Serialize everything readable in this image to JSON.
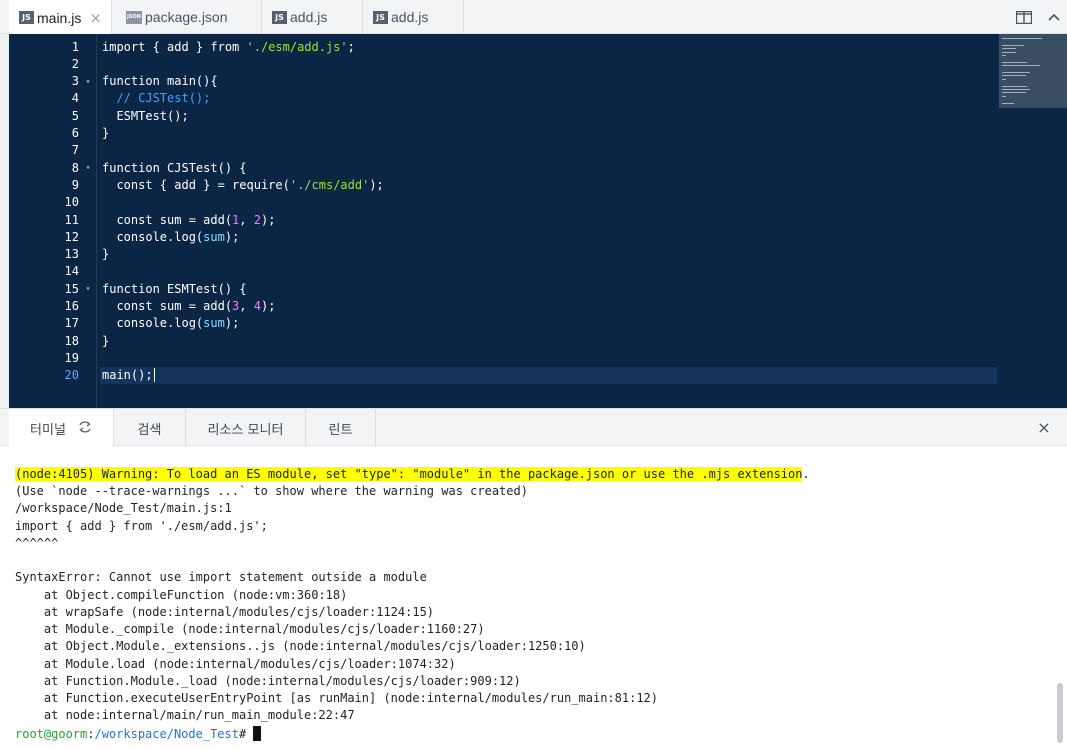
{
  "editor_tabs": [
    {
      "icon": "JS",
      "label": "main.js",
      "close": "×"
    },
    {
      "icon": "JSON",
      "label": "package.json"
    },
    {
      "icon": "JS",
      "label": "add.js"
    },
    {
      "icon": "JS",
      "label": "add.js"
    }
  ],
  "code_lines": [
    {
      "n": "1",
      "fold": "",
      "parts": [
        [
          "kw",
          "import { add } from "
        ],
        [
          "str",
          "'./esm/add.js'"
        ],
        [
          "kw",
          ";"
        ]
      ]
    },
    {
      "n": "2",
      "fold": "",
      "parts": []
    },
    {
      "n": "3",
      "fold": "▾",
      "parts": [
        [
          "kw",
          "function main(){"
        ]
      ]
    },
    {
      "n": "4",
      "fold": "",
      "parts": [
        [
          "cmt",
          "  // CJSTest();"
        ]
      ]
    },
    {
      "n": "5",
      "fold": "",
      "parts": [
        [
          "fn",
          "  ESMTest();"
        ]
      ]
    },
    {
      "n": "6",
      "fold": "",
      "parts": [
        [
          "kw",
          "}"
        ]
      ]
    },
    {
      "n": "7",
      "fold": "",
      "parts": []
    },
    {
      "n": "8",
      "fold": "▾",
      "parts": [
        [
          "kw",
          "function CJSTest() {"
        ]
      ]
    },
    {
      "n": "9",
      "fold": "",
      "parts": [
        [
          "kw",
          "  const { add } = require("
        ],
        [
          "str",
          "'./cms/add'"
        ],
        [
          "kw",
          ");"
        ]
      ]
    },
    {
      "n": "10",
      "fold": "",
      "parts": []
    },
    {
      "n": "11",
      "fold": "",
      "parts": [
        [
          "kw",
          "  const sum = add("
        ],
        [
          "num",
          "1"
        ],
        [
          "kw",
          ", "
        ],
        [
          "num",
          "2"
        ],
        [
          "kw",
          ");"
        ]
      ]
    },
    {
      "n": "12",
      "fold": "",
      "parts": [
        [
          "kw",
          "  console.log("
        ],
        [
          "vr",
          "sum"
        ],
        [
          "kw",
          ");"
        ]
      ]
    },
    {
      "n": "13",
      "fold": "",
      "parts": [
        [
          "kw",
          "}"
        ]
      ]
    },
    {
      "n": "14",
      "fold": "",
      "parts": []
    },
    {
      "n": "15",
      "fold": "▾",
      "parts": [
        [
          "kw",
          "function ESMTest() {"
        ]
      ]
    },
    {
      "n": "16",
      "fold": "",
      "parts": [
        [
          "kw",
          "  const sum = add("
        ],
        [
          "num",
          "3"
        ],
        [
          "kw",
          ", "
        ],
        [
          "num",
          "4"
        ],
        [
          "kw",
          ");"
        ]
      ]
    },
    {
      "n": "17",
      "fold": "",
      "parts": [
        [
          "kw",
          "  console.log("
        ],
        [
          "vr",
          "sum"
        ],
        [
          "kw",
          ");"
        ]
      ]
    },
    {
      "n": "18",
      "fold": "",
      "parts": [
        [
          "kw",
          "}"
        ]
      ]
    },
    {
      "n": "19",
      "fold": "",
      "parts": []
    },
    {
      "n": "20",
      "fold": "",
      "parts": [
        [
          "kw",
          "main();"
        ]
      ],
      "current": true
    }
  ],
  "panel_tabs": [
    {
      "label": "터미널",
      "icon": "refresh-icon"
    },
    {
      "label": "검색"
    },
    {
      "label": "리소스 모니터"
    },
    {
      "label": "린트"
    }
  ],
  "panel_close": "×",
  "terminal": {
    "warning": "(node:4105) Warning: To load an ES module, set \"type\": \"module\" in the package.json or use the .mjs extension",
    "warning_end": ".",
    "lines": [
      "(Use `node --trace-warnings ...` to show where the warning was created)",
      "/workspace/Node_Test/main.js:1",
      "import { add } from './esm/add.js';",
      "^^^^^^",
      "",
      "SyntaxError: Cannot use import statement outside a module",
      "    at Object.compileFunction (node:vm:360:18)",
      "    at wrapSafe (node:internal/modules/cjs/loader:1124:15)",
      "    at Module._compile (node:internal/modules/cjs/loader:1160:27)",
      "    at Object.Module._extensions..js (node:internal/modules/cjs/loader:1250:10)",
      "    at Module.load (node:internal/modules/cjs/loader:1074:32)",
      "    at Function.Module._load (node:internal/modules/cjs/loader:909:12)",
      "    at Function.executeUserEntryPoint [as runMain] (node:internal/modules/run_main:81:12)",
      "    at node:internal/main/run_main_module:22:47"
    ],
    "prompt_user": "root@goorm",
    "prompt_sep": ":",
    "prompt_path": "/workspace/Node_Test",
    "prompt_end": "#"
  },
  "colors": {
    "editor_bg": "#0b2545",
    "highlight": "#ffff00",
    "prompt_user": "#2e9e3a",
    "prompt_path": "#2a6fd6"
  }
}
